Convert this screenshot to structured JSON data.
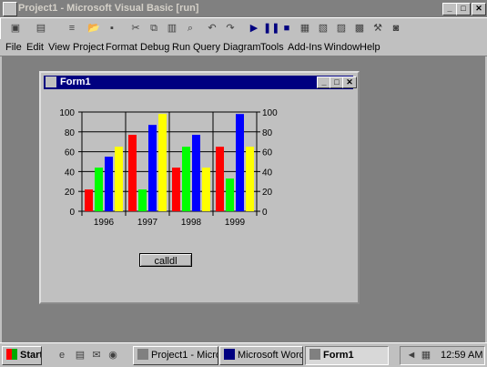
{
  "window": {
    "title": "Project1 - Microsoft Visual Basic [run]"
  },
  "menu": [
    "File",
    "Edit",
    "View",
    "Project",
    "Format",
    "Debug",
    "Run",
    "Query",
    "Diagram",
    "Tools",
    "Add-Ins",
    "Window",
    "Help"
  ],
  "form": {
    "title": "Form1",
    "button_label": "calldl"
  },
  "chart_data": {
    "type": "bar",
    "categories": [
      "1996",
      "1997",
      "1998",
      "1999"
    ],
    "series": [
      {
        "color": "#ff0000",
        "values": [
          22,
          77,
          44,
          65
        ]
      },
      {
        "color": "#00ff00",
        "values": [
          44,
          22,
          65,
          33
        ]
      },
      {
        "color": "#0000ff",
        "values": [
          55,
          87,
          77,
          98
        ]
      },
      {
        "color": "#ffff00",
        "values": [
          65,
          98,
          44,
          65
        ]
      }
    ],
    "ylim": [
      0,
      100
    ],
    "yticks": [
      "0",
      "20",
      "40",
      "60",
      "80",
      "100"
    ],
    "grid": true
  },
  "taskbar": {
    "start": "Start",
    "tasks": [
      "Project1 - Micro...",
      "Microsoft Word",
      "Form1"
    ],
    "clock": "12:59 AM"
  },
  "icons": {
    "start": "windows-flag-icon",
    "clock": "speaker-icon"
  }
}
